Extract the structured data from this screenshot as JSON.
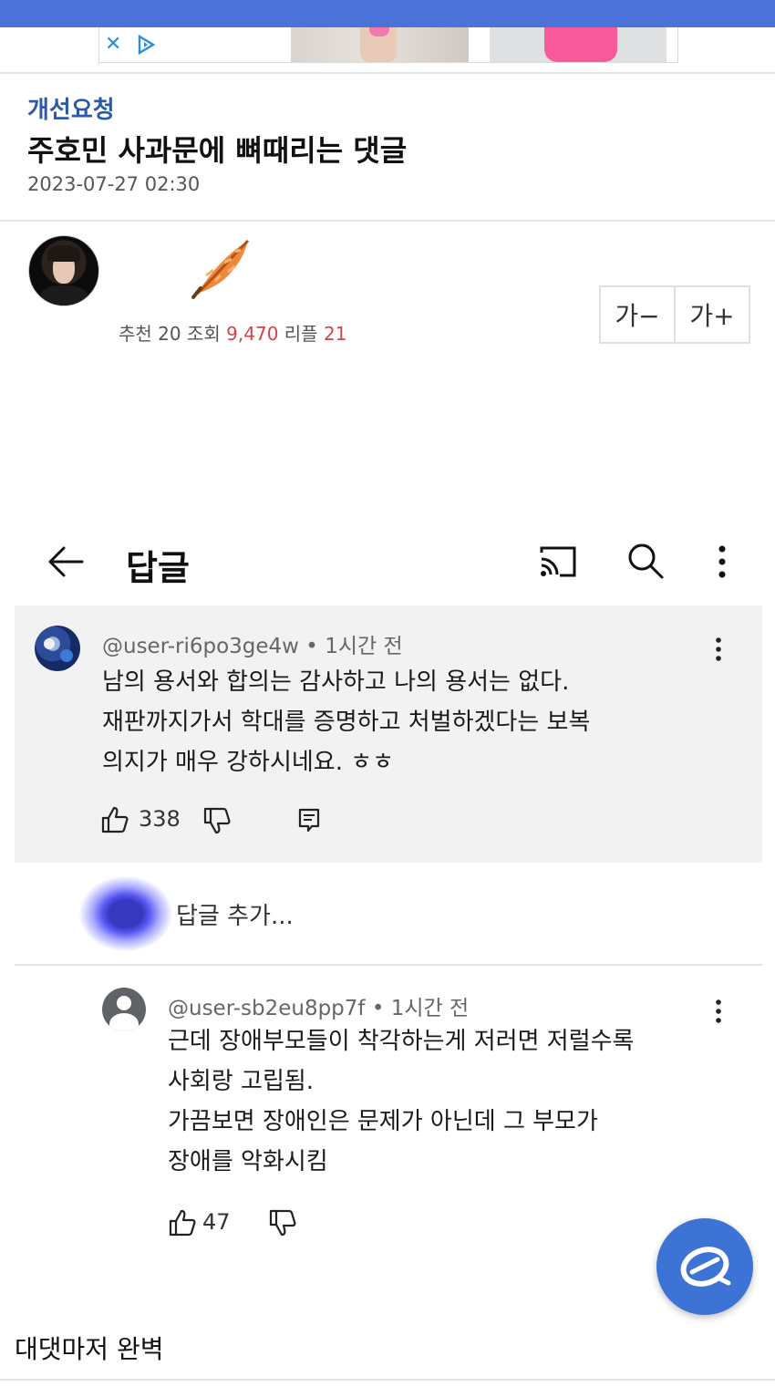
{
  "post": {
    "category": "개선요청",
    "title": "주호민 사과문에 뼈때리는 댓글",
    "date": "2023-07-27 02:30",
    "stats": {
      "recommend_label": "추천",
      "recommend_count": "20",
      "views_label": "조회",
      "views_count": "9,470",
      "replies_label": "리플",
      "replies_count": "21"
    },
    "font_controls": {
      "decrease_label": "가−",
      "increase_label": "가+"
    },
    "caption": "대댓마저 완벽"
  },
  "youtube": {
    "header": {
      "title": "답글"
    },
    "comment": {
      "author": "@user-ri6po3ge4w",
      "time": "1시간 전",
      "text": "남의 용서와 합의는 감사하고 나의 용서는 없다.\n재판까지가서 학대를 증명하고 처벌하겠다는 보복\n의지가 매우 강하시네요. ㅎㅎ",
      "likes": "338"
    },
    "add_reply_placeholder": "답글 추가...",
    "reply": {
      "author": "@user-sb2eu8pp7f",
      "time": "1시간 전",
      "text": "근데 장애부모들이 착각하는게 저러면 저럴수록\n사회랑 고립됨.\n가끔보면 장애인은 문제가 아닌데 그 부모가\n장애를 악화시킴",
      "likes": "47"
    }
  },
  "colors": {
    "top_bar": "#4a72d9",
    "category": "#2d5aa8",
    "stat_highlight": "#d04545",
    "fab": "#3e73d6"
  }
}
